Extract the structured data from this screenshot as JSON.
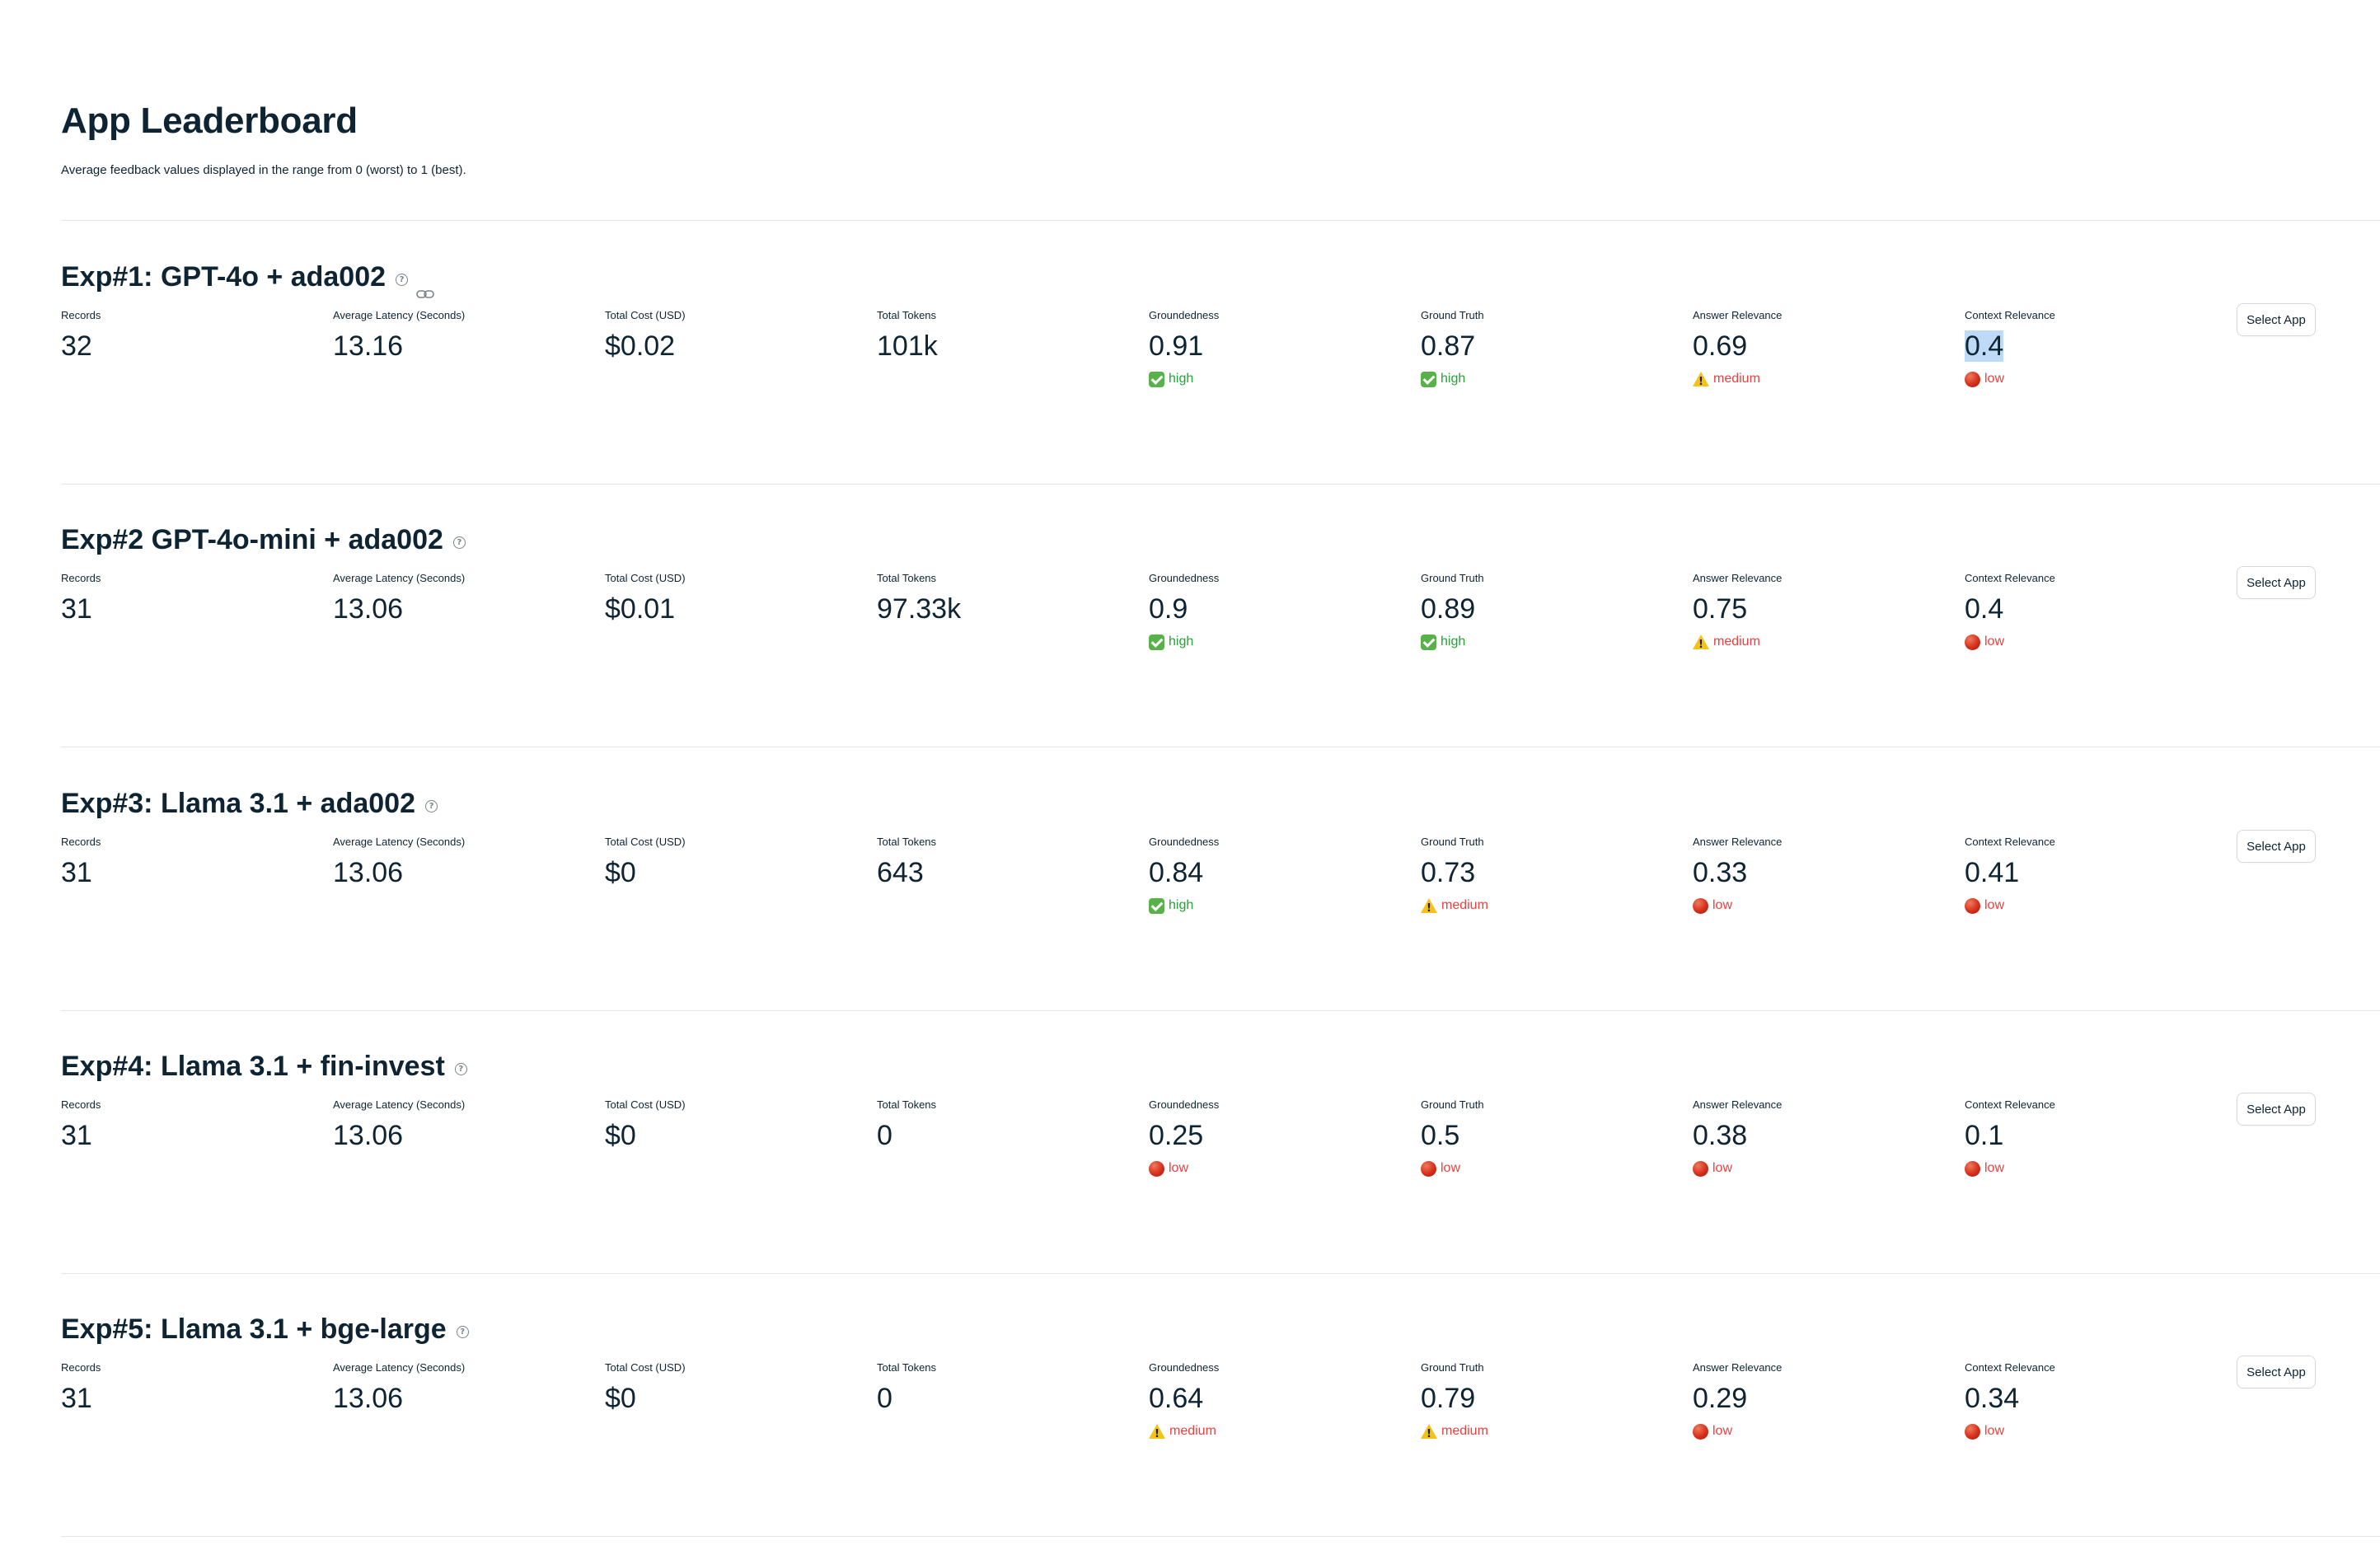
{
  "page": {
    "title": "App Leaderboard",
    "subtitle": "Average feedback values displayed in the range from 0 (worst) to 1 (best)."
  },
  "metric_labels": {
    "records": "Records",
    "latency": "Average Latency (Seconds)",
    "cost": "Total Cost (USD)",
    "tokens": "Total Tokens",
    "groundedness": "Groundedness",
    "ground_truth": "Ground Truth",
    "answer_relevance": "Answer Relevance",
    "context_relevance": "Context Relevance"
  },
  "select_label": "Select App",
  "icons": {
    "help": "help-circle-icon",
    "link": "link-icon",
    "high": "check-mark-button-icon",
    "medium": "warning-icon",
    "low": "red-circle-icon"
  },
  "colors": {
    "text": "#0e2433",
    "high": "#21a336",
    "medium": "#e8413f",
    "low": "#e8413f",
    "highlight": "#bfdaf7"
  },
  "apps": [
    {
      "title": "Exp#1: GPT-4o + ada002",
      "records": "32",
      "latency": "13.16",
      "cost": "$0.02",
      "tokens": "101k",
      "groundedness": {
        "value": "0.91",
        "level": "high"
      },
      "ground_truth": {
        "value": "0.87",
        "level": "high"
      },
      "answer_relevance": {
        "value": "0.69",
        "level": "medium"
      },
      "context_relevance": {
        "value": "0.4",
        "level": "low"
      }
    },
    {
      "title": "Exp#2 GPT-4o-mini + ada002",
      "records": "31",
      "latency": "13.06",
      "cost": "$0.01",
      "tokens": "97.33k",
      "groundedness": {
        "value": "0.9",
        "level": "high"
      },
      "ground_truth": {
        "value": "0.89",
        "level": "high"
      },
      "answer_relevance": {
        "value": "0.75",
        "level": "medium"
      },
      "context_relevance": {
        "value": "0.4",
        "level": "low"
      }
    },
    {
      "title": "Exp#3: Llama 3.1 + ada002",
      "records": "31",
      "latency": "13.06",
      "cost": "$0",
      "tokens": "643",
      "groundedness": {
        "value": "0.84",
        "level": "high"
      },
      "ground_truth": {
        "value": "0.73",
        "level": "medium"
      },
      "answer_relevance": {
        "value": "0.33",
        "level": "low"
      },
      "context_relevance": {
        "value": "0.41",
        "level": "low"
      }
    },
    {
      "title": "Exp#4: Llama 3.1 + fin-invest",
      "records": "31",
      "latency": "13.06",
      "cost": "$0",
      "tokens": "0",
      "groundedness": {
        "value": "0.25",
        "level": "low"
      },
      "ground_truth": {
        "value": "0.5",
        "level": "low"
      },
      "answer_relevance": {
        "value": "0.38",
        "level": "low"
      },
      "context_relevance": {
        "value": "0.1",
        "level": "low"
      }
    },
    {
      "title": "Exp#5: Llama 3.1 + bge-large",
      "records": "31",
      "latency": "13.06",
      "cost": "$0",
      "tokens": "0",
      "groundedness": {
        "value": "0.64",
        "level": "medium"
      },
      "ground_truth": {
        "value": "0.79",
        "level": "medium"
      },
      "answer_relevance": {
        "value": "0.29",
        "level": "low"
      },
      "context_relevance": {
        "value": "0.34",
        "level": "low"
      }
    }
  ]
}
